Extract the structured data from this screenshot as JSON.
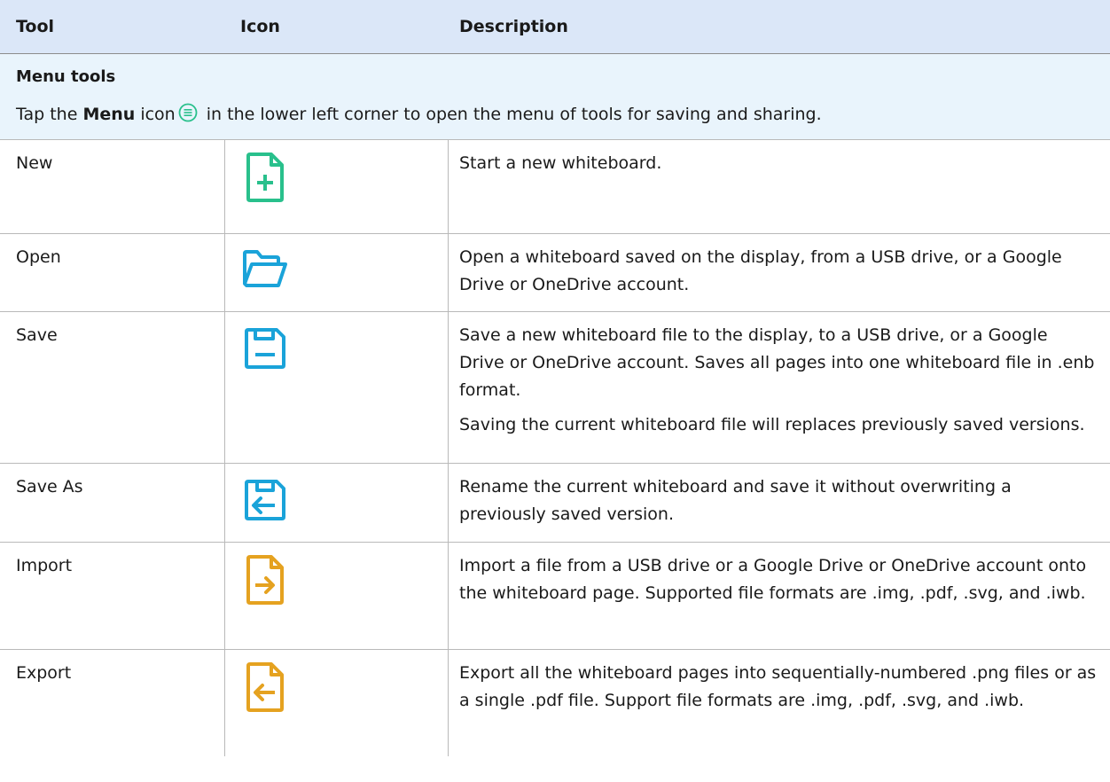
{
  "header": {
    "col_tool": "Tool",
    "col_icon": "Icon",
    "col_description": "Description"
  },
  "section": {
    "title": "Menu tools",
    "desc_prefix": "Tap the ",
    "desc_bold": "Menu",
    "desc_mid": " icon",
    "desc_suffix": " in the lower left corner to open the menu of tools for saving and sharing.",
    "menu_icon": "menu-circle-icon"
  },
  "colors": {
    "green": "#29c08c",
    "blue": "#1aa3d9",
    "orange": "#e5a220"
  },
  "rows": [
    {
      "tool": "New",
      "icon": "new-file-icon",
      "desc": [
        "Start a new whiteboard."
      ]
    },
    {
      "tool": "Open",
      "icon": "open-folder-icon",
      "desc": [
        "Open a whiteboard saved on the display, from a USB drive, or a Google Drive or OneDrive account."
      ]
    },
    {
      "tool": "Save",
      "icon": "save-disk-icon",
      "desc": [
        "Save a new whiteboard file to the display, to a USB drive, or a Google Drive or OneDrive account. Saves all pages into one whiteboard file in .enb format.",
        "Saving the current whiteboard file will replaces previously saved versions."
      ]
    },
    {
      "tool": "Save As",
      "icon": "save-as-icon",
      "desc": [
        "Rename the current whiteboard and save it without overwriting a previously saved version."
      ]
    },
    {
      "tool": "Import",
      "icon": "import-file-icon",
      "desc": [
        "Import a file from a USB drive or a Google Drive or OneDrive account onto the whiteboard page. Supported file formats are .img, .pdf, .svg, and .iwb."
      ]
    },
    {
      "tool": "Export",
      "icon": "export-file-icon",
      "desc": [
        "Export all the whiteboard pages into sequentially-numbered .png files or as a single .pdf file. Support file formats are .img, .pdf, .svg, and .iwb."
      ]
    }
  ]
}
